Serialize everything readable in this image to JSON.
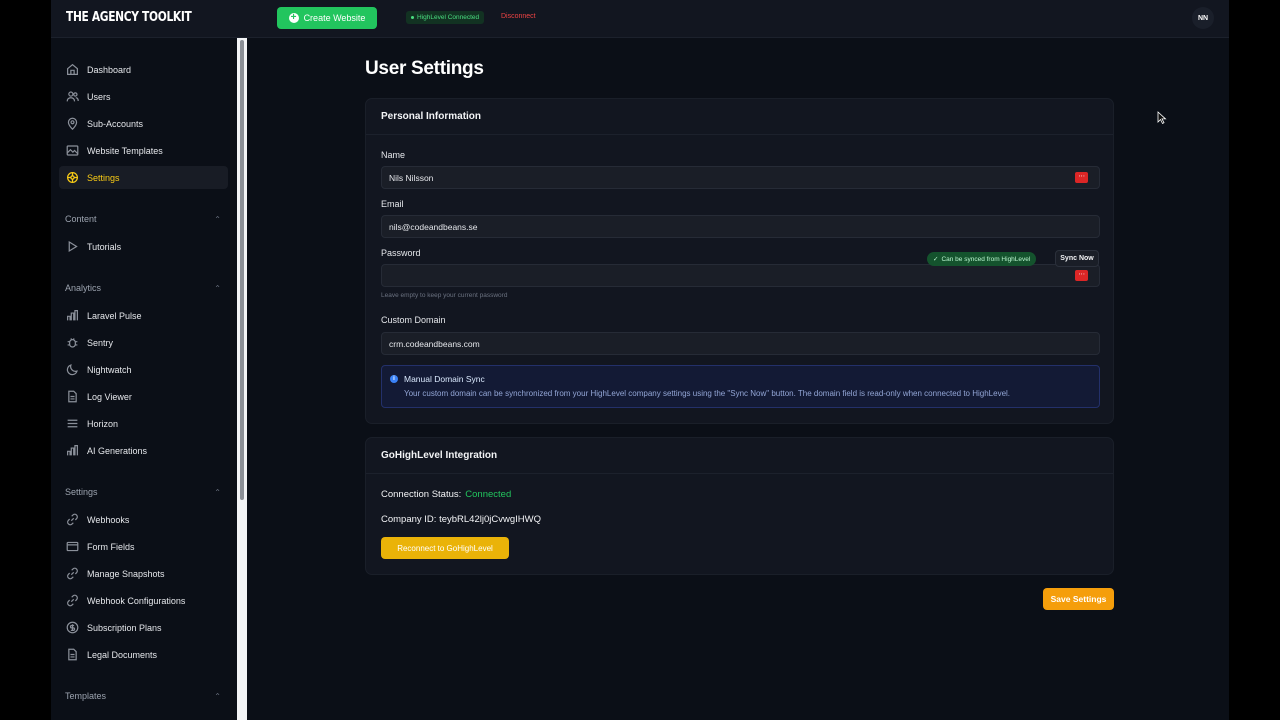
{
  "app": {
    "logo": "THE AGENCY TOOLKIT"
  },
  "topbar": {
    "create_label": "Create Website",
    "connection_badge": "HighLevel Connected",
    "disconnect_label": "Disconnect",
    "avatar_initials": "NN"
  },
  "sidebar": {
    "main_items": [
      {
        "label": "Dashboard",
        "icon": "home-icon"
      },
      {
        "label": "Users",
        "icon": "users-icon"
      },
      {
        "label": "Sub-Accounts",
        "icon": "map-pin-icon"
      },
      {
        "label": "Website Templates",
        "icon": "image-icon"
      },
      {
        "label": "Settings",
        "icon": "settings-icon",
        "active": true
      }
    ],
    "content": {
      "label": "Content",
      "items": [
        {
          "label": "Tutorials",
          "icon": "play-icon"
        }
      ]
    },
    "analytics": {
      "label": "Analytics",
      "items": [
        {
          "label": "Laravel Pulse",
          "icon": "bar-chart-icon"
        },
        {
          "label": "Sentry",
          "icon": "bug-icon"
        },
        {
          "label": "Nightwatch",
          "icon": "moon-icon"
        },
        {
          "label": "Log Viewer",
          "icon": "document-icon"
        },
        {
          "label": "Horizon",
          "icon": "stack-icon"
        },
        {
          "label": "AI Generations",
          "icon": "bar-chart-icon"
        }
      ]
    },
    "settings": {
      "label": "Settings",
      "items": [
        {
          "label": "Webhooks",
          "icon": "link-icon"
        },
        {
          "label": "Form Fields",
          "icon": "form-icon"
        },
        {
          "label": "Manage Snapshots",
          "icon": "link-icon"
        },
        {
          "label": "Webhook Configurations",
          "icon": "link-icon"
        },
        {
          "label": "Subscription Plans",
          "icon": "dollar-icon"
        },
        {
          "label": "Legal Documents",
          "icon": "document-icon"
        }
      ]
    },
    "templates": {
      "label": "Templates"
    }
  },
  "page": {
    "title": "User Settings"
  },
  "personal": {
    "header": "Personal Information",
    "name_label": "Name",
    "name_value": "Nils Nilsson",
    "email_label": "Email",
    "email_value": "nils@codeandbeans.se",
    "password_label": "Password",
    "password_value": "",
    "password_hint": "Leave empty to keep your current password",
    "domain_label": "Custom Domain",
    "sync_badge": "Can be synced from HighLevel",
    "sync_button": "Sync Now",
    "domain_value": "crm.codeandbeans.com",
    "info_title": "Manual Domain Sync",
    "info_text": "Your custom domain can be synchronized from your HighLevel company settings using the \"Sync Now\" button. The domain field is read-only when connected to HighLevel."
  },
  "integration": {
    "header": "GoHighLevel Integration",
    "status_label": "Connection Status:",
    "status_value": "Connected",
    "company_label": "Company ID:",
    "company_value": "teybRL42lj0jCvwgIHWQ",
    "reconnect_button": "Reconnect to GoHighLevel"
  },
  "footer": {
    "save_button": "Save Settings"
  },
  "colors": {
    "accent": "#facc15",
    "success": "#22c55e",
    "danger": "#ef4444",
    "save": "#f59e0b"
  }
}
